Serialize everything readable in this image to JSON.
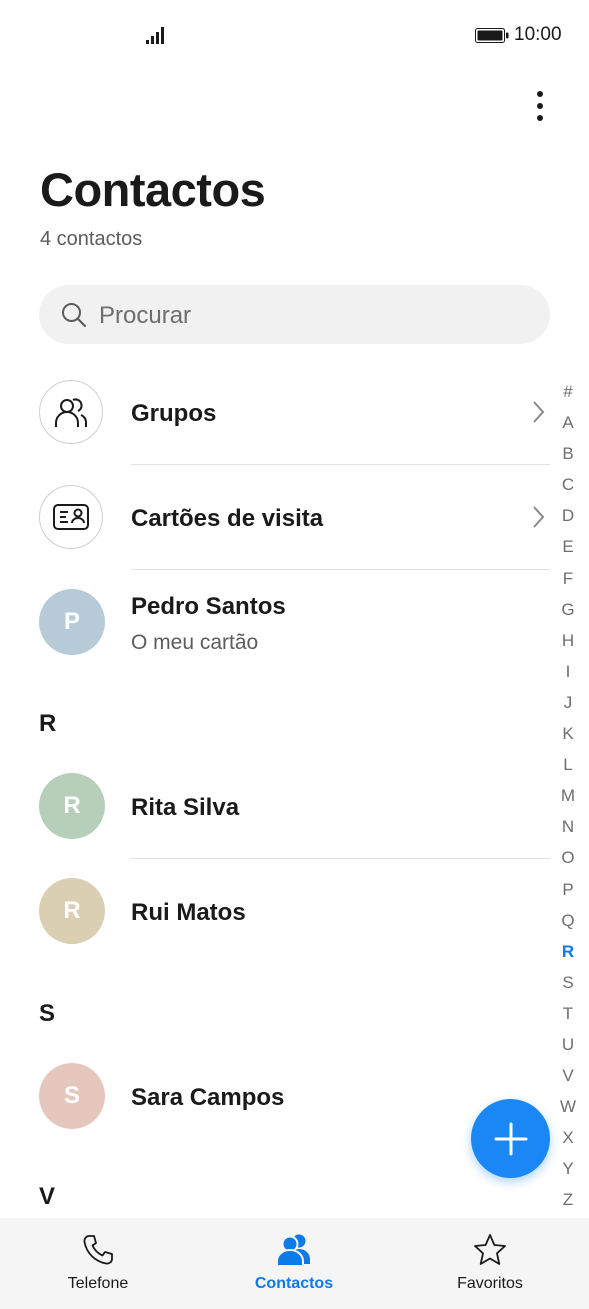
{
  "status_bar": {
    "time": "10:00"
  },
  "header": {
    "title": "Contactos",
    "count": "4 contactos"
  },
  "search": {
    "placeholder": "Procurar"
  },
  "special_rows": [
    {
      "label": "Grupos",
      "icon": "group-icon"
    },
    {
      "label": "Cartões de visita",
      "icon": "business-card-icon"
    }
  ],
  "my_card": {
    "initial": "P",
    "name": "Pedro Santos",
    "subtitle": "O meu cartão",
    "color": "#b7cad8"
  },
  "sections": [
    {
      "letter": "R",
      "contacts": [
        {
          "initial": "R",
          "name": "Rita Silva",
          "color": "#b5cfb8"
        },
        {
          "initial": "R",
          "name": "Rui Matos",
          "color": "#dacfb3"
        }
      ]
    },
    {
      "letter": "S",
      "contacts": [
        {
          "initial": "S",
          "name": "Sara Campos",
          "color": "#e6c7be"
        }
      ]
    },
    {
      "letter": "V",
      "contacts": []
    }
  ],
  "index_letters": [
    "#",
    "A",
    "B",
    "C",
    "D",
    "E",
    "F",
    "G",
    "H",
    "I",
    "J",
    "K",
    "L",
    "M",
    "N",
    "O",
    "P",
    "Q",
    "R",
    "S",
    "T",
    "U",
    "V",
    "W",
    "X",
    "Y",
    "Z"
  ],
  "index_active": "R",
  "bottom_nav": [
    {
      "label": "Telefone",
      "icon": "phone-icon",
      "active": false
    },
    {
      "label": "Contactos",
      "icon": "contacts-icon",
      "active": true
    },
    {
      "label": "Favoritos",
      "icon": "star-icon",
      "active": false
    }
  ],
  "colors": {
    "accent": "#0a7be8",
    "fab": "#1a87f5"
  }
}
